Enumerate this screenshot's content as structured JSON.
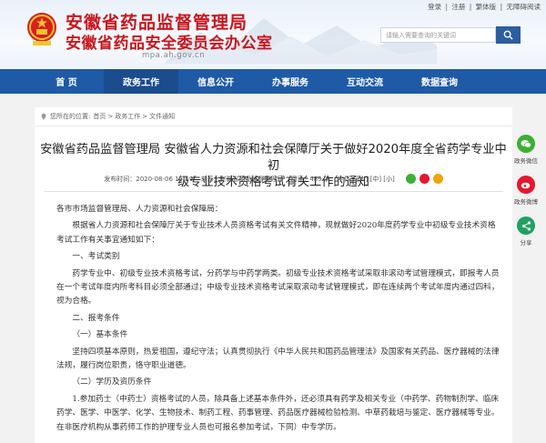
{
  "header": {
    "title": "安徽省药品监督管理局",
    "subtitle": "安徽省药品安全委员会办公室",
    "url": "mpa.ah.gov.cn",
    "toplinks": [
      "登录",
      "|",
      "注册",
      "|",
      "繁体版",
      "|",
      "无障碍阅读"
    ],
    "search_placeholder": "请输入需要查询的关键词"
  },
  "nav": {
    "items": [
      "首 页",
      "政务工作",
      "信息公开",
      "办事服务",
      "互动交流",
      "数据查询"
    ],
    "active_index": 1
  },
  "breadcrumb": {
    "label": "您所在的位置:",
    "items": [
      "首页",
      "政务工作",
      "文件通知"
    ],
    "separator": ">"
  },
  "article": {
    "title_line1": "安徽省药品监督管理局 安徽省人力资源和社会保障厅关于做好2020年度全省药学专业中初",
    "title_line2": "级专业技术资格考试有关工作的通知",
    "meta_date": "发布时间：2020-08-06 15:59",
    "meta_source": "来源：安徽省药品监督管理局",
    "meta_views": "阅读：489 次",
    "meta_fontsize": "字体：[大] [中] [小]",
    "paragraphs": [
      "各市市场监督管理局、人力资源和社会保障局：",
      "根据省人力资源和社会保障厅关于专业技术人员资格考试有关文件精神，现就做好2020年度药学专业中初级专业技术资格考试工作有关事宜通知如下：",
      "一、考试类别",
      "药学专业中、初级专业技术资格考试，分药学与中药学两类。初级专业技术资格考试采取非滚动考试管理模式，即报考人员在一个考试年度内所考科目必须全部通过；中级专业技术资格考试采取滚动考试管理模式，即在连续两个考试年度内通过四科，视为合格。",
      "二、报考条件",
      "（一）基本条件",
      "坚持四项基本原则，热爱祖国，遵纪守法；认真贯彻执行《中华人民共和国药品管理法》及国家有关药品、医疗器械的法律法规，履行岗位职责，恪守职业道德。",
      "（二）学历及资历条件",
      "1.参加药士（中药士）资格考试的人员，除具备上述基本条件外，还必须具有药学及相关专业（中药学、药物制剂学、临床药学、医学、中医学、化学、生物技术、制药工程、药事管理、药品医疗器械检验检测、中草药栽培与鉴定、医疗器械等专业。在非医疗机构从事药师工作的护理专业人员也可报名参加考试，下同）中专学历。"
    ]
  },
  "side": {
    "items": [
      "政务微信",
      "政务微博",
      "分享"
    ]
  },
  "colors": {
    "nav_bg": "#1e5aa6",
    "title_red": "#c8161d"
  }
}
